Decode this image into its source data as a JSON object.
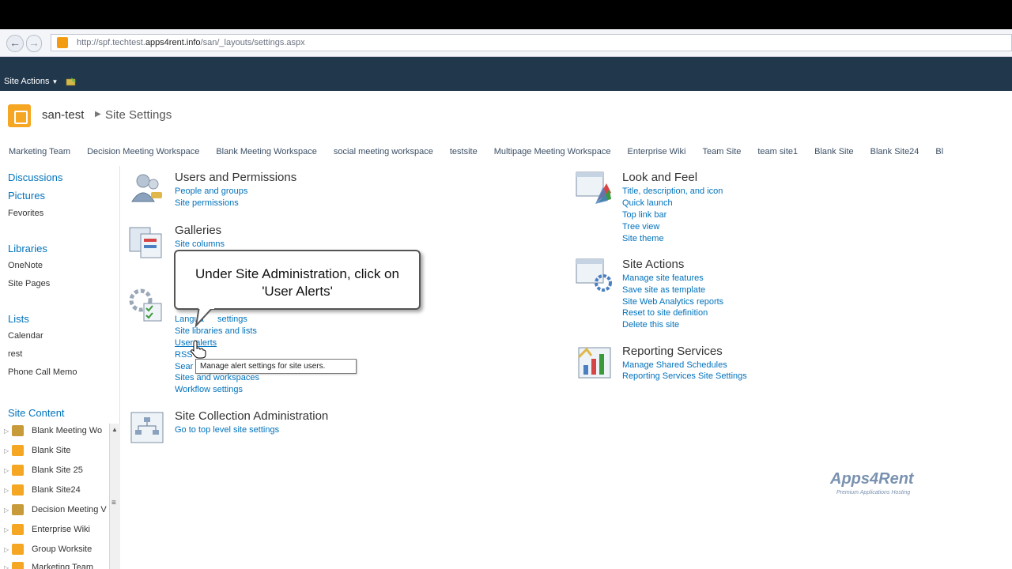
{
  "browser": {
    "url_prefix": "http://spf.techtest.",
    "url_domain": "apps4rent.info",
    "url_path": "/san/_layouts/settings.aspx"
  },
  "ribbon": {
    "site_actions": "Site Actions"
  },
  "header": {
    "site_name": "san-test",
    "page_title": "Site Settings"
  },
  "topnav": [
    "Marketing Team",
    "Decision Meeting Workspace",
    "Blank Meeting Workspace",
    "social meeting workspace",
    "testsite",
    "Multipage Meeting Workspace",
    "Enterprise Wiki",
    "Team Site",
    "team site1",
    "Blank Site",
    "Blank Site24",
    "Bl"
  ],
  "leftnav": {
    "discussions": "Discussions",
    "pictures": "Pictures",
    "favorites": "Fevorites",
    "libraries": "Libraries",
    "onenote": "OneNote",
    "site_pages": "Site Pages",
    "lists": "Lists",
    "calendar": "Calendar",
    "rest": "rest",
    "phone_call_memo": "Phone Call Memo",
    "site_content": "Site Content",
    "tree": [
      "Blank Meeting Wo",
      "Blank Site",
      "Blank Site 25",
      "Blank Site24",
      "Decision Meeting V",
      "Enterprise Wiki",
      "Group Worksite",
      "Marketing Team"
    ]
  },
  "sections": {
    "users": {
      "title": "Users and Permissions",
      "links": [
        "People and groups",
        "Site permissions"
      ]
    },
    "galleries": {
      "title": "Galleries",
      "links": [
        "Site columns"
      ]
    },
    "site_admin": {
      "links": [
        "Langua",
        "settings",
        "Site libraries and lists",
        "User alerts",
        "RSS",
        "Sear",
        "Sites and workspaces",
        "Workflow settings"
      ]
    },
    "site_collection": {
      "title": "Site Collection Administration",
      "links": [
        "Go to top level site settings"
      ]
    },
    "look_feel": {
      "title": "Look and Feel",
      "links": [
        "Title, description, and icon",
        "Quick launch",
        "Top link bar",
        "Tree view",
        "Site theme"
      ]
    },
    "site_actions": {
      "title": "Site Actions",
      "links": [
        "Manage site features",
        "Save site as template",
        "Site Web Analytics reports",
        "Reset to site definition",
        "Delete this site"
      ]
    },
    "reporting": {
      "title": "Reporting Services",
      "links": [
        "Manage Shared Schedules",
        "Reporting Services Site Settings"
      ]
    }
  },
  "callout": {
    "line1": "Under Site Administration, click on",
    "line2": "'User Alerts'"
  },
  "tooltip": "Manage alert settings for site users.",
  "brand": {
    "name": "Apps4Rent",
    "tagline": "Premium Applications Hosting"
  },
  "colors": {
    "ribbon": "#21374c",
    "link": "#0072bc",
    "accent": "#f5a623"
  }
}
